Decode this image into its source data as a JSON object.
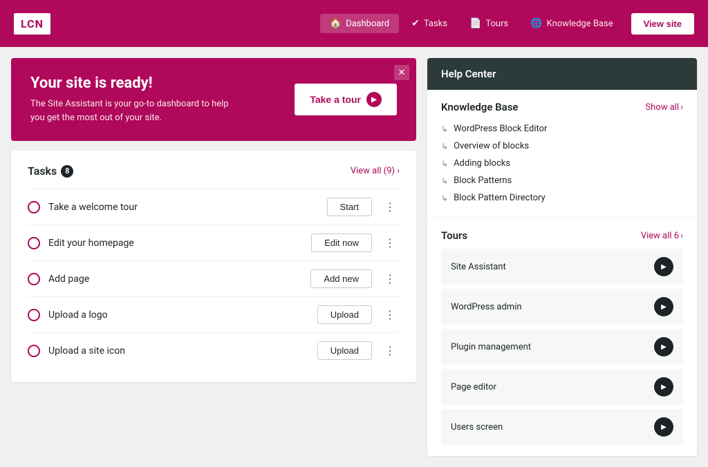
{
  "header": {
    "logo": "LCN",
    "nav_items": [
      {
        "label": "Dashboard",
        "icon": "🏠",
        "active": true
      },
      {
        "label": "Tasks",
        "icon": "✔",
        "active": false
      },
      {
        "label": "Tours",
        "icon": "📄",
        "active": false
      },
      {
        "label": "Knowledge Base",
        "icon": "🌐",
        "active": false
      }
    ],
    "view_site_label": "View site"
  },
  "hero": {
    "title": "Your site is ready!",
    "subtitle": "The Site Assistant is your go-to dashboard to help you get the most out of your site.",
    "tour_button": "Take a tour"
  },
  "tasks": {
    "title": "Tasks",
    "count": "8",
    "view_all": "View all (9)",
    "items": [
      {
        "label": "Take a welcome tour",
        "action": "Start"
      },
      {
        "label": "Edit your homepage",
        "action": "Edit now"
      },
      {
        "label": "Add page",
        "action": "Add new"
      },
      {
        "label": "Upload a logo",
        "action": "Upload"
      },
      {
        "label": "Upload a site icon",
        "action": "Upload"
      }
    ]
  },
  "help_center": {
    "title": "Help Center",
    "knowledge_base": {
      "title": "Knowledge Base",
      "show_all": "Show all",
      "items": [
        "WordPress Block Editor",
        "Overview of blocks",
        "Adding blocks",
        "Block Patterns",
        "Block Pattern Directory"
      ]
    },
    "tours": {
      "title": "Tours",
      "view_all": "View all 6",
      "items": [
        "Site Assistant",
        "WordPress admin",
        "Plugin management",
        "Page editor",
        "Users screen"
      ]
    }
  }
}
